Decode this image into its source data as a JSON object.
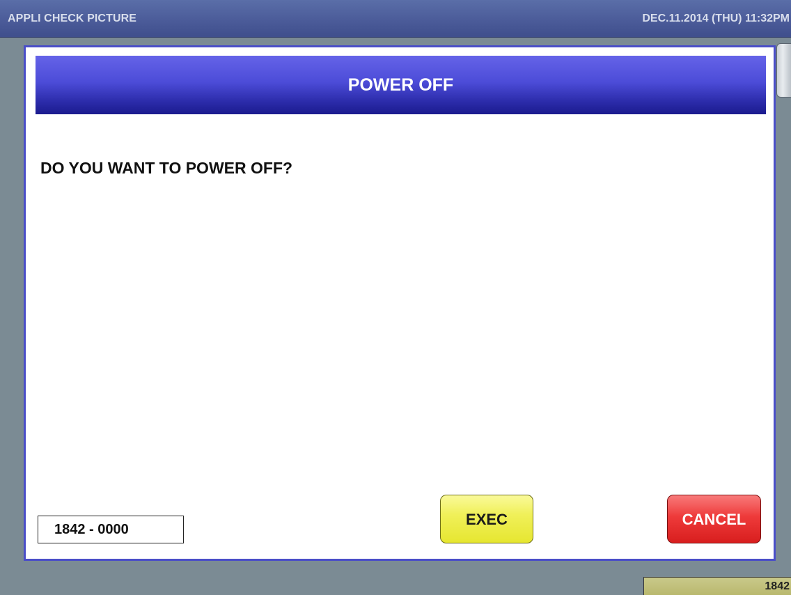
{
  "app": {
    "title": "APPLI CHECK PICTURE",
    "datetime": "DEC.11.2014 (THU)  11:32PM"
  },
  "dialog": {
    "title": "POWER OFF",
    "message": "DO YOU WANT TO POWER OFF?",
    "code": "1842 - 0000",
    "buttons": {
      "exec_label": "EXEC",
      "cancel_label": "CANCEL"
    }
  },
  "status": {
    "counter": "1842"
  },
  "colors": {
    "header_blue": "#4c4cd8",
    "dialog_border": "#4a4ec8",
    "exec_yellow": "#f0f05a",
    "cancel_red": "#ee3a3a",
    "background_gray": "#7b8b94"
  }
}
